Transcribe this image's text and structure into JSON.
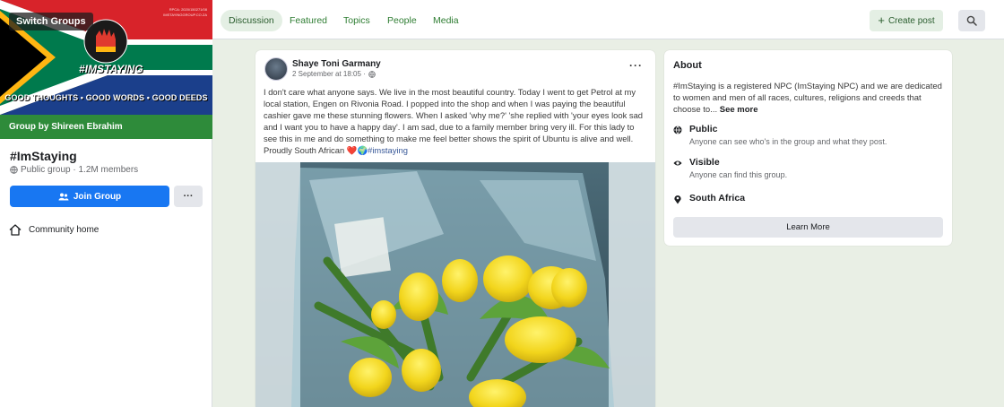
{
  "sidebar": {
    "switch_groups": "Switch Groups",
    "cover": {
      "reg_line1": "RPCA: 2020/150271/08",
      "reg_line2": "IMSTAYINGGROUP.CO.ZA",
      "brand": "#IMSTAYING",
      "slogan": "GOOD THOUGHTS • GOOD WORDS • GOOD DEEDS"
    },
    "group_by": "Group by Shireen Ebrahim",
    "group_name": "#ImStaying",
    "group_meta": "Public group · 1.2M members",
    "join_label": "Join Group",
    "more_label": "···",
    "community_home": "Community home"
  },
  "nav": {
    "tabs": [
      {
        "label": "Discussion",
        "active": true
      },
      {
        "label": "Featured"
      },
      {
        "label": "Topics"
      },
      {
        "label": "People"
      },
      {
        "label": "Media"
      }
    ],
    "create_post": "Create post"
  },
  "post": {
    "author": "Shaye Toni Garmany",
    "time": "2 September at 18:05 ·",
    "text": "I don't care what anyone says. We live in the most beautiful country. Today I went to get Petrol at my local station, Engen on Rivonia Road. I popped into the shop and when I was paying the beautiful cashier gave me these stunning flowers. When I asked 'why me?' 'she replied with 'your eyes look sad and I want you to have a happy day'. I am sad, due to a family member bring very ill. For this lady to see this in me and do something to make me feel better shows the spirit of Ubuntu is alive and well. Proudly South African ",
    "emoji": "❤️🌍",
    "hashtag": "#imstaying"
  },
  "about": {
    "title": "About",
    "description": "#ImStaying is a registered NPC (ImStaying NPC) and we are dedicated to women and men of all races, cultures, religions and creeds that choose to... ",
    "see_more": "See more",
    "items": [
      {
        "icon": "globe-icon",
        "title": "Public",
        "subtitle": "Anyone can see who's in the group and what they post."
      },
      {
        "icon": "eye-icon",
        "title": "Visible",
        "subtitle": "Anyone can find this group."
      },
      {
        "icon": "location-pin-icon",
        "title": "South Africa",
        "subtitle": ""
      }
    ],
    "learn_more": "Learn More"
  },
  "colors": {
    "accent_green": "#2e8b3a",
    "join_blue": "#1877f2",
    "tab_green": "#2e7d32"
  }
}
